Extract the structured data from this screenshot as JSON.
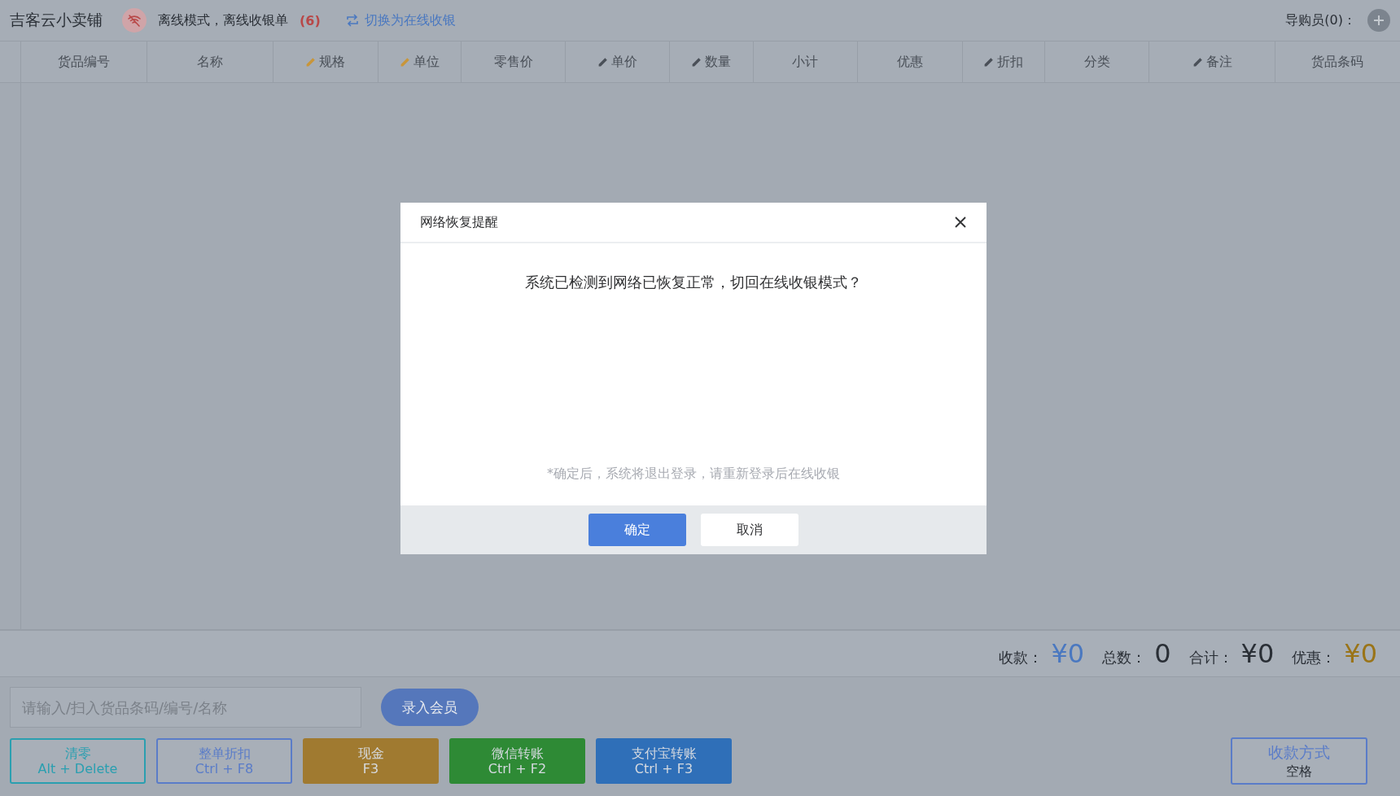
{
  "top_bar": {
    "store_name": "吉客云小卖铺",
    "offline_status": "离线模式，离线收银单",
    "offline_count": "(6)",
    "switch_link": "切换为在线收银",
    "guide_label": "导购员(0)："
  },
  "table": {
    "columns": [
      {
        "label": "货品编号",
        "editable": false
      },
      {
        "label": "名称",
        "editable": false
      },
      {
        "label": "规格",
        "editable": true,
        "color": "#c8963a"
      },
      {
        "label": "单位",
        "editable": true,
        "color": "#c8963a"
      },
      {
        "label": "零售价",
        "editable": false
      },
      {
        "label": "单价",
        "editable": true,
        "color": "#4a5058"
      },
      {
        "label": "数量",
        "editable": true,
        "color": "#4a5058"
      },
      {
        "label": "小计",
        "editable": false
      },
      {
        "label": "优惠",
        "editable": false
      },
      {
        "label": "折扣",
        "editable": true,
        "color": "#4a5058"
      },
      {
        "label": "分类",
        "editable": false
      },
      {
        "label": "备注",
        "editable": true,
        "color": "#4a5058"
      },
      {
        "label": "货品条码",
        "editable": false
      }
    ]
  },
  "totals": [
    {
      "label": "收款：",
      "value": "¥0",
      "color": "#4a78c0"
    },
    {
      "label": "总数：",
      "value": "0",
      "color": "#2a2f36"
    },
    {
      "label": "合计：",
      "value": "¥0",
      "color": "#2a2f36"
    },
    {
      "label": "优惠：",
      "value": "¥0",
      "color": "#9a7418"
    }
  ],
  "search": {
    "placeholder": "请输入/扫入货品条码/编号/名称"
  },
  "member_button": "录入会员",
  "action_buttons": [
    {
      "label": "清零",
      "shortcut": "Alt + Delete",
      "kind": "outline",
      "color": "#2a9fb0"
    },
    {
      "label": "整单折扣",
      "shortcut": "Ctrl + F8",
      "kind": "outline",
      "color": "#5a7cc8"
    },
    {
      "label": "现金",
      "shortcut": "F3",
      "kind": "filled",
      "color": "#a07a30"
    },
    {
      "label": "微信转账",
      "shortcut": "Ctrl + F2",
      "kind": "filled",
      "color": "#2e8a35"
    },
    {
      "label": "支付宝转账",
      "shortcut": "Ctrl + F3",
      "kind": "filled",
      "color": "#2f6fb8"
    }
  ],
  "payment_button": {
    "label": "收款方式",
    "shortcut": "空格"
  },
  "dialog": {
    "title": "网络恢复提醒",
    "message": "系统已检测到网络已恢复正常，切回在线收银模式？",
    "note": "*确定后，系统将退出登录，请重新登录后在线收银",
    "buttons": [
      {
        "label": "确定",
        "primary": true
      },
      {
        "label": "取消",
        "primary": false
      }
    ]
  }
}
